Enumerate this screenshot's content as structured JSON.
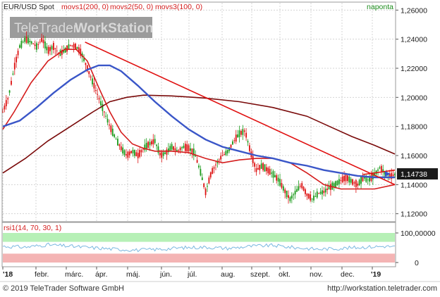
{
  "header": {
    "symbol": "EUR/USD Spot",
    "ma_labels": [
      "movs1(200, 0)",
      "movs2(50, 0)",
      "movs3(100, 0)"
    ],
    "period": "naponta"
  },
  "watermark": {
    "part1": "TeleTrader",
    "part2": "WorkStation"
  },
  "rsi_panel": {
    "label": "rsi1(14, 70, 30, 1)"
  },
  "footer": {
    "copyright": "© 2019 TeleTrader Software GmbH",
    "url": "http://workstation.teletrader.com"
  },
  "colors": {
    "up_candle": "#1a9a1a",
    "down_candle": "#dd1111",
    "ma200": "#7a0a0a",
    "ma50": "#d41c1c",
    "ma100": "#3a56c8",
    "trendline": "#e01010",
    "rsi_line": "#7ab8e0",
    "rsi_overbought_band": "#b6f0b6",
    "rsi_oversold_band": "#f4b4b4",
    "price_tag_bg": "#1a1a1a"
  },
  "chart_data": [
    {
      "type": "candlestick",
      "title": "EUR/USD Spot",
      "ylim": [
        1.115,
        1.265
      ],
      "y_ticks": [
        "1,26000",
        "1,24000",
        "1,22000",
        "1,20000",
        "1,18000",
        "1,16000",
        "1,14000",
        "1,12000"
      ],
      "x_ticks": [
        "'18",
        "febr.",
        "márc.",
        "ápr.",
        "máj.",
        "jún.",
        "júl.",
        "aug.",
        "szept.",
        "okt.",
        "nov.",
        "dec.",
        "'19"
      ],
      "last_price_label": "1,14738",
      "last_price": 1.1474,
      "series": [
        {
          "name": "movs1(200, 0)",
          "values": [
            [
              0,
              1.148
            ],
            [
              20,
              1.158
            ],
            [
              40,
              1.17
            ],
            [
              60,
              1.18
            ],
            [
              80,
              1.19
            ],
            [
              95,
              1.197
            ],
            [
              110,
              1.2
            ],
            [
              125,
              1.2015
            ],
            [
              150,
              1.201
            ],
            [
              180,
              1.1995
            ],
            [
              210,
              1.197
            ],
            [
              240,
              1.193
            ],
            [
              270,
              1.187
            ],
            [
              290,
              1.18
            ],
            [
              310,
              1.173
            ],
            [
              330,
              1.167
            ],
            [
              348,
              1.161
            ]
          ]
        },
        {
          "name": "movs2(50, 0)",
          "values": [
            [
              0,
              1.178
            ],
            [
              10,
              1.19
            ],
            [
              25,
              1.21
            ],
            [
              40,
              1.225
            ],
            [
              55,
              1.233
            ],
            [
              65,
              1.233
            ],
            [
              75,
              1.225
            ],
            [
              85,
              1.207
            ],
            [
              95,
              1.19
            ],
            [
              105,
              1.176
            ],
            [
              115,
              1.168
            ],
            [
              125,
              1.165
            ],
            [
              135,
              1.163
            ],
            [
              150,
              1.163
            ],
            [
              165,
              1.162
            ],
            [
              180,
              1.158
            ],
            [
              195,
              1.155
            ],
            [
              210,
              1.157
            ],
            [
              225,
              1.158
            ],
            [
              240,
              1.158
            ],
            [
              255,
              1.155
            ],
            [
              270,
              1.148
            ],
            [
              285,
              1.14
            ],
            [
              300,
              1.137
            ],
            [
              315,
              1.137
            ],
            [
              330,
              1.137
            ],
            [
              348,
              1.14
            ]
          ]
        },
        {
          "name": "movs3(100, 0)",
          "values": [
            [
              0,
              1.18
            ],
            [
              15,
              1.184
            ],
            [
              30,
              1.193
            ],
            [
              45,
              1.203
            ],
            [
              60,
              1.212
            ],
            [
              75,
              1.219
            ],
            [
              85,
              1.222
            ],
            [
              95,
              1.222
            ],
            [
              105,
              1.218
            ],
            [
              120,
              1.208
            ],
            [
              135,
              1.197
            ],
            [
              150,
              1.187
            ],
            [
              165,
              1.178
            ],
            [
              180,
              1.171
            ],
            [
              195,
              1.166
            ],
            [
              210,
              1.163
            ],
            [
              225,
              1.16
            ],
            [
              240,
              1.158
            ],
            [
              255,
              1.155
            ],
            [
              270,
              1.153
            ],
            [
              285,
              1.15
            ],
            [
              300,
              1.148
            ],
            [
              315,
              1.146
            ],
            [
              330,
              1.145
            ],
            [
              348,
              1.145
            ]
          ]
        },
        {
          "name": "price",
          "values": [
            [
              0,
              1.19
            ],
            [
              5,
              1.2
            ],
            [
              10,
              1.22
            ],
            [
              15,
              1.235
            ],
            [
              20,
              1.24
            ],
            [
              25,
              1.238
            ],
            [
              30,
              1.235
            ],
            [
              35,
              1.24
            ],
            [
              40,
              1.232
            ],
            [
              45,
              1.235
            ],
            [
              50,
              1.23
            ],
            [
              55,
              1.232
            ],
            [
              60,
              1.236
            ],
            [
              65,
              1.235
            ],
            [
              70,
              1.23
            ],
            [
              75,
              1.22
            ],
            [
              80,
              1.21
            ],
            [
              85,
              1.2
            ],
            [
              90,
              1.19
            ],
            [
              95,
              1.18
            ],
            [
              100,
              1.172
            ],
            [
              105,
              1.165
            ],
            [
              110,
              1.16
            ],
            [
              115,
              1.163
            ],
            [
              120,
              1.16
            ],
            [
              125,
              1.165
            ],
            [
              130,
              1.168
            ],
            [
              135,
              1.17
            ],
            [
              140,
              1.16
            ],
            [
              145,
              1.162
            ],
            [
              150,
              1.166
            ],
            [
              155,
              1.163
            ],
            [
              160,
              1.166
            ],
            [
              165,
              1.165
            ],
            [
              170,
              1.162
            ],
            [
              175,
              1.15
            ],
            [
              180,
              1.135
            ],
            [
              185,
              1.148
            ],
            [
              190,
              1.155
            ],
            [
              195,
              1.16
            ],
            [
              200,
              1.163
            ],
            [
              205,
              1.17
            ],
            [
              210,
              1.175
            ],
            [
              215,
              1.177
            ],
            [
              220,
              1.162
            ],
            [
              225,
              1.15
            ],
            [
              230,
              1.153
            ],
            [
              235,
              1.15
            ],
            [
              240,
              1.147
            ],
            [
              245,
              1.143
            ],
            [
              250,
              1.136
            ],
            [
              255,
              1.13
            ],
            [
              260,
              1.135
            ],
            [
              265,
              1.14
            ],
            [
              270,
              1.133
            ],
            [
              275,
              1.13
            ],
            [
              280,
              1.134
            ],
            [
              285,
              1.135
            ],
            [
              290,
              1.138
            ],
            [
              295,
              1.14
            ],
            [
              300,
              1.143
            ],
            [
              305,
              1.145
            ],
            [
              310,
              1.142
            ],
            [
              315,
              1.14
            ],
            [
              320,
              1.145
            ],
            [
              325,
              1.143
            ],
            [
              330,
              1.147
            ],
            [
              335,
              1.152
            ],
            [
              340,
              1.147
            ],
            [
              345,
              1.146
            ],
            [
              348,
              1.147
            ]
          ]
        }
      ],
      "trendlines": [
        {
          "name": "trendline-upper",
          "from": [
            73,
            1.238
          ],
          "to": [
            348,
            1.14
          ]
        },
        {
          "name": "trendline-lower",
          "from": [
            320,
            1.147
          ],
          "to": [
            348,
            1.15
          ]
        }
      ]
    },
    {
      "type": "line",
      "title": "rsi1(14, 70, 30, 1)",
      "ylim": [
        0,
        100
      ],
      "y_ticks": [
        "100,00000",
        "0"
      ],
      "bands": {
        "overbought": [
          70,
          100
        ],
        "oversold": [
          0,
          30
        ]
      },
      "series": [
        {
          "name": "rsi1(14, 70, 30, 1)",
          "values": [
            [
              0,
              55
            ],
            [
              20,
              52
            ],
            [
              40,
              60
            ],
            [
              60,
              55
            ],
            [
              80,
              50
            ],
            [
              100,
              45
            ],
            [
              120,
              42
            ],
            [
              140,
              45
            ],
            [
              160,
              50
            ],
            [
              180,
              52
            ],
            [
              200,
              48
            ],
            [
              220,
              55
            ],
            [
              240,
              58
            ],
            [
              260,
              50
            ],
            [
              280,
              45
            ],
            [
              300,
              48
            ],
            [
              320,
              52
            ],
            [
              340,
              55
            ],
            [
              348,
              53
            ]
          ]
        }
      ]
    }
  ]
}
